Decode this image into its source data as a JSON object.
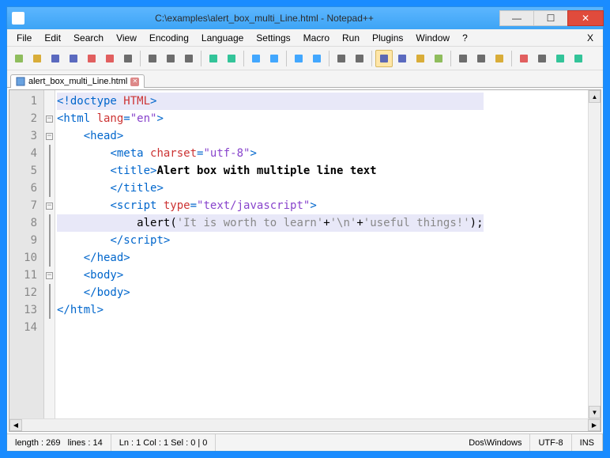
{
  "window": {
    "title": "C:\\examples\\alert_box_multi_Line.html - Notepad++"
  },
  "menu": {
    "items": [
      "File",
      "Edit",
      "Search",
      "View",
      "Encoding",
      "Language",
      "Settings",
      "Macro",
      "Run",
      "Plugins",
      "Window",
      "?"
    ],
    "x": "X"
  },
  "toolbar_icons": [
    "new-file-icon",
    "open-icon",
    "save-icon",
    "save-all-icon",
    "close-icon",
    "close-all-icon",
    "print-icon",
    "cut-icon",
    "copy-icon",
    "paste-icon",
    "undo-icon",
    "redo-icon",
    "find-icon",
    "replace-icon",
    "zoom-in-icon",
    "zoom-out-icon",
    "sync-v-icon",
    "sync-h-icon",
    "wrap-icon",
    "all-chars-icon",
    "indent-guide-icon",
    "lang-icon",
    "doc-map-icon",
    "func-list-icon",
    "folder-icon",
    "record-icon",
    "stop-icon",
    "play-icon",
    "play-multi-icon"
  ],
  "toolbar_colors": [
    "#7cb342",
    "#d4a017",
    "#3f51b5",
    "#3f51b5",
    "#d44",
    "#d44",
    "#555",
    "#555",
    "#555",
    "#555",
    "#1b8",
    "#1b8",
    "#29f",
    "#29f",
    "#29f",
    "#29f",
    "#555",
    "#555",
    "#3f51b5",
    "#3f51b5",
    "#d4a017",
    "#7cb342",
    "#555",
    "#555",
    "#d4a017",
    "#d44",
    "#555",
    "#1b8",
    "#1b8"
  ],
  "tab": {
    "name": "alert_box_multi_Line.html"
  },
  "code": {
    "lines": [
      {
        "indent": "",
        "tokens": [
          {
            "t": "<!doctype ",
            "c": "blue"
          },
          {
            "t": "HTML",
            "c": "red"
          },
          {
            "t": ">",
            "c": "blue"
          }
        ],
        "hl": true
      },
      {
        "indent": "",
        "tokens": [
          {
            "t": "<html ",
            "c": "blue"
          },
          {
            "t": "lang",
            "c": "red"
          },
          {
            "t": "=",
            "c": "blue"
          },
          {
            "t": "\"en\"",
            "c": "purple"
          },
          {
            "t": ">",
            "c": "blue"
          }
        ]
      },
      {
        "indent": "    ",
        "tokens": [
          {
            "t": "<head>",
            "c": "blue"
          }
        ]
      },
      {
        "indent": "        ",
        "tokens": [
          {
            "t": "<meta ",
            "c": "blue"
          },
          {
            "t": "charset",
            "c": "red"
          },
          {
            "t": "=",
            "c": "blue"
          },
          {
            "t": "\"utf-8\"",
            "c": "purple"
          },
          {
            "t": ">",
            "c": "blue"
          }
        ]
      },
      {
        "indent": "        ",
        "tokens": [
          {
            "t": "<title>",
            "c": "blue"
          },
          {
            "t": "Alert box with multiple line text",
            "c": "black"
          }
        ]
      },
      {
        "indent": "        ",
        "tokens": [
          {
            "t": "</title>",
            "c": "blue"
          }
        ]
      },
      {
        "indent": "        ",
        "tokens": [
          {
            "t": "<script ",
            "c": "blue"
          },
          {
            "t": "type",
            "c": "red"
          },
          {
            "t": "=",
            "c": "blue"
          },
          {
            "t": "\"text/javascript\"",
            "c": "purple"
          },
          {
            "t": ">",
            "c": "blue"
          }
        ]
      },
      {
        "indent": "            ",
        "tokens": [
          {
            "t": "alert",
            "c": "normal"
          },
          {
            "t": "(",
            "c": "normal"
          },
          {
            "t": "'It is worth to learn'",
            "c": "grey"
          },
          {
            "t": "+",
            "c": "normal"
          },
          {
            "t": "'\\n'",
            "c": "grey"
          },
          {
            "t": "+",
            "c": "normal"
          },
          {
            "t": "'useful things!'",
            "c": "grey"
          },
          {
            "t": ")",
            "c": "normal"
          },
          {
            "t": ";",
            "c": "normal"
          }
        ],
        "hl": true
      },
      {
        "indent": "        ",
        "tokens": [
          {
            "t": "</script>",
            "c": "blue"
          }
        ]
      },
      {
        "indent": "    ",
        "tokens": [
          {
            "t": "</head>",
            "c": "blue"
          }
        ]
      },
      {
        "indent": "    ",
        "tokens": [
          {
            "t": "<body>",
            "c": "blue"
          }
        ]
      },
      {
        "indent": "    ",
        "tokens": [
          {
            "t": "</body>",
            "c": "blue"
          }
        ]
      },
      {
        "indent": "",
        "tokens": [
          {
            "t": "</html>",
            "c": "blue"
          }
        ]
      },
      {
        "indent": "",
        "tokens": []
      }
    ],
    "fold": [
      "",
      "box",
      "box",
      "",
      "",
      "",
      "box",
      "",
      "",
      "",
      "box",
      "",
      "",
      ""
    ]
  },
  "status": {
    "length": "length : 269",
    "lines": "lines : 14",
    "pos": "Ln : 1    Col : 1    Sel : 0 | 0",
    "eol": "Dos\\Windows",
    "enc": "UTF-8",
    "ins": "INS"
  }
}
